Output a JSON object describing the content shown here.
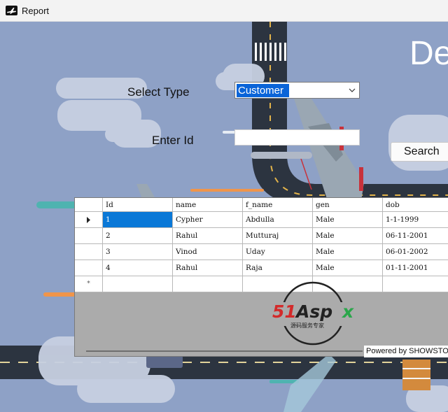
{
  "window": {
    "title": "Report"
  },
  "form": {
    "select_type_label": "Select Type",
    "select_type_value": "Customer",
    "enter_id_label": "Enter Id",
    "id_value": "",
    "search_label": "Search",
    "banner_text": "De"
  },
  "grid": {
    "columns": [
      "Id",
      "name",
      "f_name",
      "gen",
      "dob"
    ],
    "rows": [
      [
        "1",
        "Cypher",
        "Abdulla",
        "Male",
        "1-1-1999"
      ],
      [
        "2",
        "Rahul",
        "Mutturaj",
        "Male",
        "06-11-2001"
      ],
      [
        "3",
        "Vinod",
        "Uday",
        "Male",
        "06-01-2002"
      ],
      [
        "4",
        "Rahul",
        "Raja",
        "Male",
        "01-11-2001"
      ]
    ],
    "new_row_marker": "*"
  },
  "watermark": {
    "brand": "51Aspx",
    "tagline": "源码服务专家"
  },
  "footer": {
    "powered_by": "Powered by  SHOWSTO"
  }
}
